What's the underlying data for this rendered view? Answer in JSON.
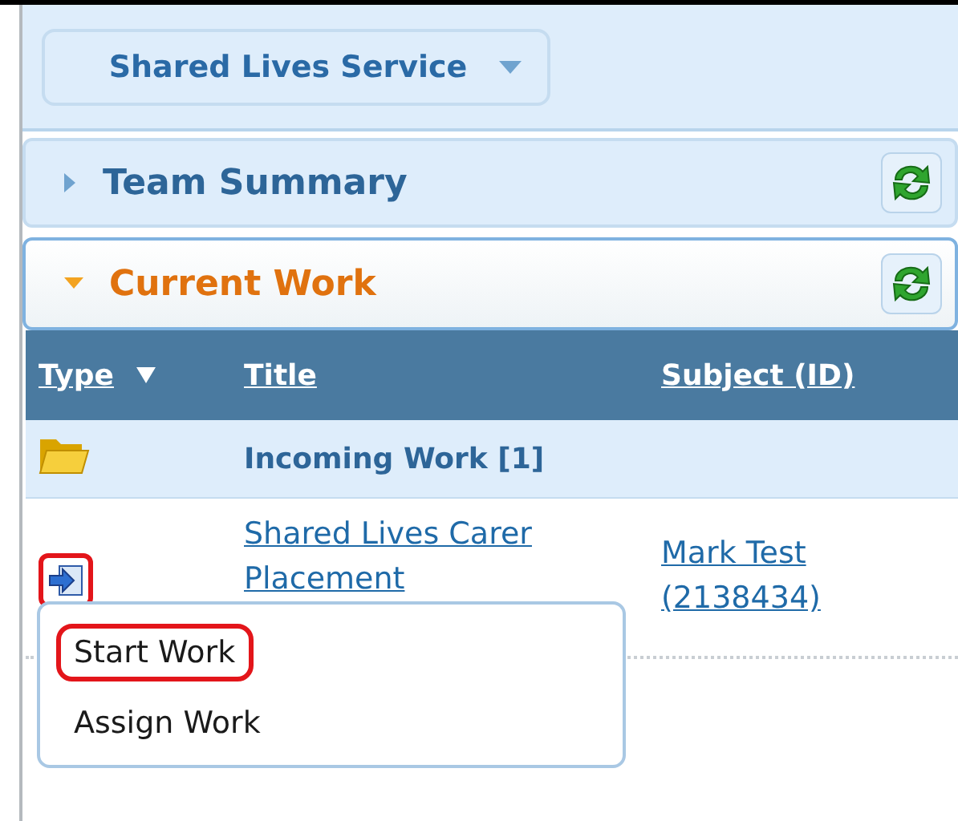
{
  "service_selector": {
    "label": "Shared Lives Service"
  },
  "panels": [
    {
      "title": "Team Summary",
      "expanded": false
    },
    {
      "title": "Current Work",
      "expanded": true
    }
  ],
  "table": {
    "columns": [
      {
        "label": "Type",
        "sorted": true
      },
      {
        "label": "Title",
        "sorted": false
      },
      {
        "label": "Subject (ID)",
        "sorted": false
      }
    ],
    "group": {
      "label": "Incoming Work [1]"
    },
    "rows": [
      {
        "kind": "task",
        "highlighted": true,
        "title_lines": [
          "Shared Lives Carer",
          "Placement"
        ],
        "subject_lines": [
          "Mark Test",
          "(2138434)"
        ]
      }
    ]
  },
  "context_menu": [
    {
      "label": "Start Work",
      "highlighted": true
    },
    {
      "label": "Assign Work",
      "highlighted": false
    }
  ]
}
